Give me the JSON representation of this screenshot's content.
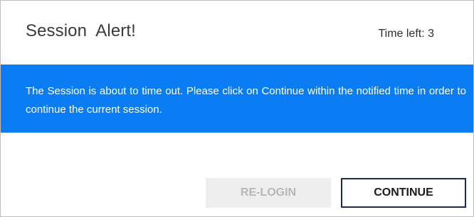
{
  "dialog": {
    "title": "Session  Alert!",
    "time_left_label": "Time left: 3",
    "message": "The Session is about to time out. Please click on Continue within the notified time in order to continue the current session.",
    "buttons": {
      "relogin_label": "RE-LOGIN",
      "continue_label": "CONTINUE"
    }
  },
  "colors": {
    "banner": "#0a7df5",
    "continue_border": "#1a2a55",
    "relogin_bg": "#eeeeee"
  }
}
